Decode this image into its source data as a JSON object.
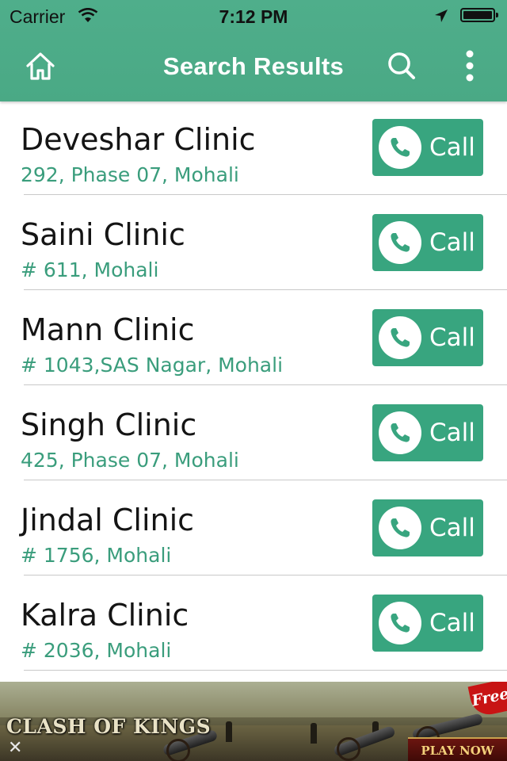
{
  "status_bar": {
    "carrier": "Carrier",
    "time": "7:12 PM"
  },
  "navbar": {
    "title": "Search Results",
    "home_icon": "home-icon",
    "search_icon": "search-icon",
    "more_icon": "more-vertical-icon"
  },
  "colors": {
    "header": "#4fae8b",
    "accent": "#38a57f",
    "address_text": "#3a9d7c"
  },
  "results": [
    {
      "name": "Deveshar Clinic",
      "address": "292, Phase 07, Mohali",
      "call_label": "Call"
    },
    {
      "name": "Saini Clinic",
      "address": "# 611, Mohali",
      "call_label": "Call"
    },
    {
      "name": "Mann Clinic",
      "address": "# 1043,SAS Nagar, Mohali",
      "call_label": "Call"
    },
    {
      "name": "Singh Clinic",
      "address": "425, Phase 07, Mohali",
      "call_label": "Call"
    },
    {
      "name": "Jindal Clinic",
      "address": "# 1756, Mohali",
      "call_label": "Call"
    },
    {
      "name": "Kalra Clinic",
      "address": "# 2036, Mohali",
      "call_label": "Call"
    }
  ],
  "ad": {
    "game_title": "CLASH OF KINGS",
    "cta": "PLAY NOW",
    "badge": "Free",
    "close_icon": "close-icon"
  }
}
